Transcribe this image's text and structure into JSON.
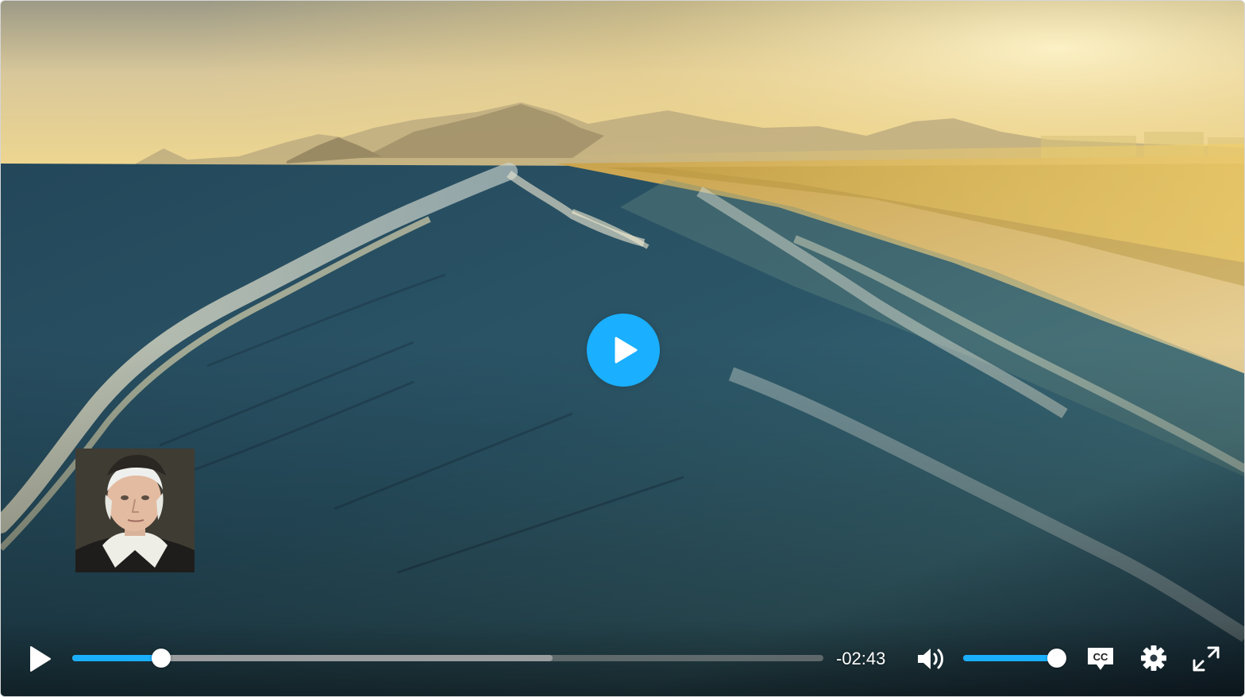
{
  "player": {
    "accent_color": "#1aafff",
    "big_play_icon": "play-icon",
    "progress_played": 0.118,
    "progress_buffered": 0.64,
    "time_remaining": "-02:43",
    "volume_level": 1.0,
    "controls": {
      "play_icon": "play-icon",
      "volume_icon": "speaker-icon",
      "captions_label": "CC",
      "settings_icon": "gear-icon",
      "fullscreen_icon": "fullscreen-icon"
    }
  }
}
